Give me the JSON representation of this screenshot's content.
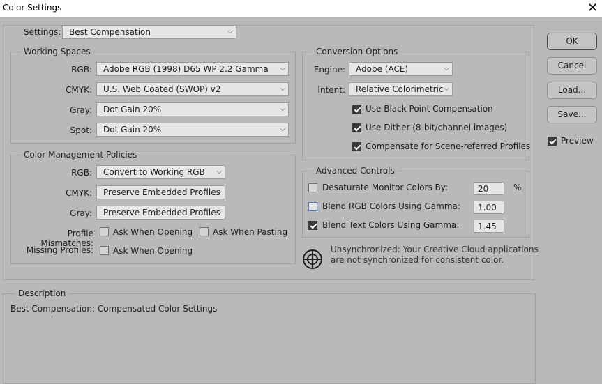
{
  "window": {
    "title": "Color Settings"
  },
  "settings": {
    "label": "Settings:",
    "value": "Best Compensation"
  },
  "working_spaces": {
    "title": "Working Spaces",
    "rgb": {
      "label": "RGB:",
      "value": "Adobe RGB (1998) D65 WP 2.2 Gamma"
    },
    "cmyk": {
      "label": "CMYK:",
      "value": "U.S. Web Coated (SWOP) v2"
    },
    "gray": {
      "label": "Gray:",
      "value": "Dot Gain 20%"
    },
    "spot": {
      "label": "Spot:",
      "value": "Dot Gain 20%"
    }
  },
  "policies": {
    "title": "Color Management Policies",
    "rgb": {
      "label": "RGB:",
      "value": "Convert to Working RGB"
    },
    "cmyk": {
      "label": "CMYK:",
      "value": "Preserve Embedded Profiles"
    },
    "gray": {
      "label": "Gray:",
      "value": "Preserve Embedded Profiles"
    },
    "mismatches_label": "Profile Mismatches:",
    "ask_opening": {
      "label": "Ask When Opening",
      "checked": false
    },
    "ask_pasting": {
      "label": "Ask When Pasting",
      "checked": false
    },
    "missing_label": "Missing Profiles:",
    "missing_ask_opening": {
      "label": "Ask When Opening",
      "checked": false
    }
  },
  "conversion": {
    "title": "Conversion Options",
    "engine": {
      "label": "Engine:",
      "value": "Adobe (ACE)"
    },
    "intent": {
      "label": "Intent:",
      "value": "Relative Colorimetric"
    },
    "black_point": {
      "label": "Use Black Point Compensation",
      "checked": true
    },
    "dither": {
      "label": "Use Dither (8-bit/channel images)",
      "checked": true
    },
    "scene_referred": {
      "label": "Compensate for Scene-referred Profiles",
      "checked": true
    }
  },
  "advanced": {
    "title": "Advanced Controls",
    "desaturate": {
      "label": "Desaturate Monitor Colors By:",
      "value": "20",
      "unit": "%",
      "checked": false
    },
    "blend_rgb": {
      "label": "Blend RGB Colors Using Gamma:",
      "value": "1.00",
      "checked": false
    },
    "blend_text": {
      "label": "Blend Text Colors Using Gamma:",
      "value": "1.45",
      "checked": true
    }
  },
  "sync": {
    "icon": "color-sync-icon",
    "message_line1": "Unsynchronized: Your Creative Cloud applications",
    "message_line2": "are not synchronized for consistent color."
  },
  "buttons": {
    "ok": "OK",
    "cancel": "Cancel",
    "load": "Load...",
    "save": "Save..."
  },
  "preview": {
    "label": "Preview",
    "checked": true
  },
  "description": {
    "title": "Description",
    "text": "Best Compensation:  Compensated Color Settings"
  }
}
